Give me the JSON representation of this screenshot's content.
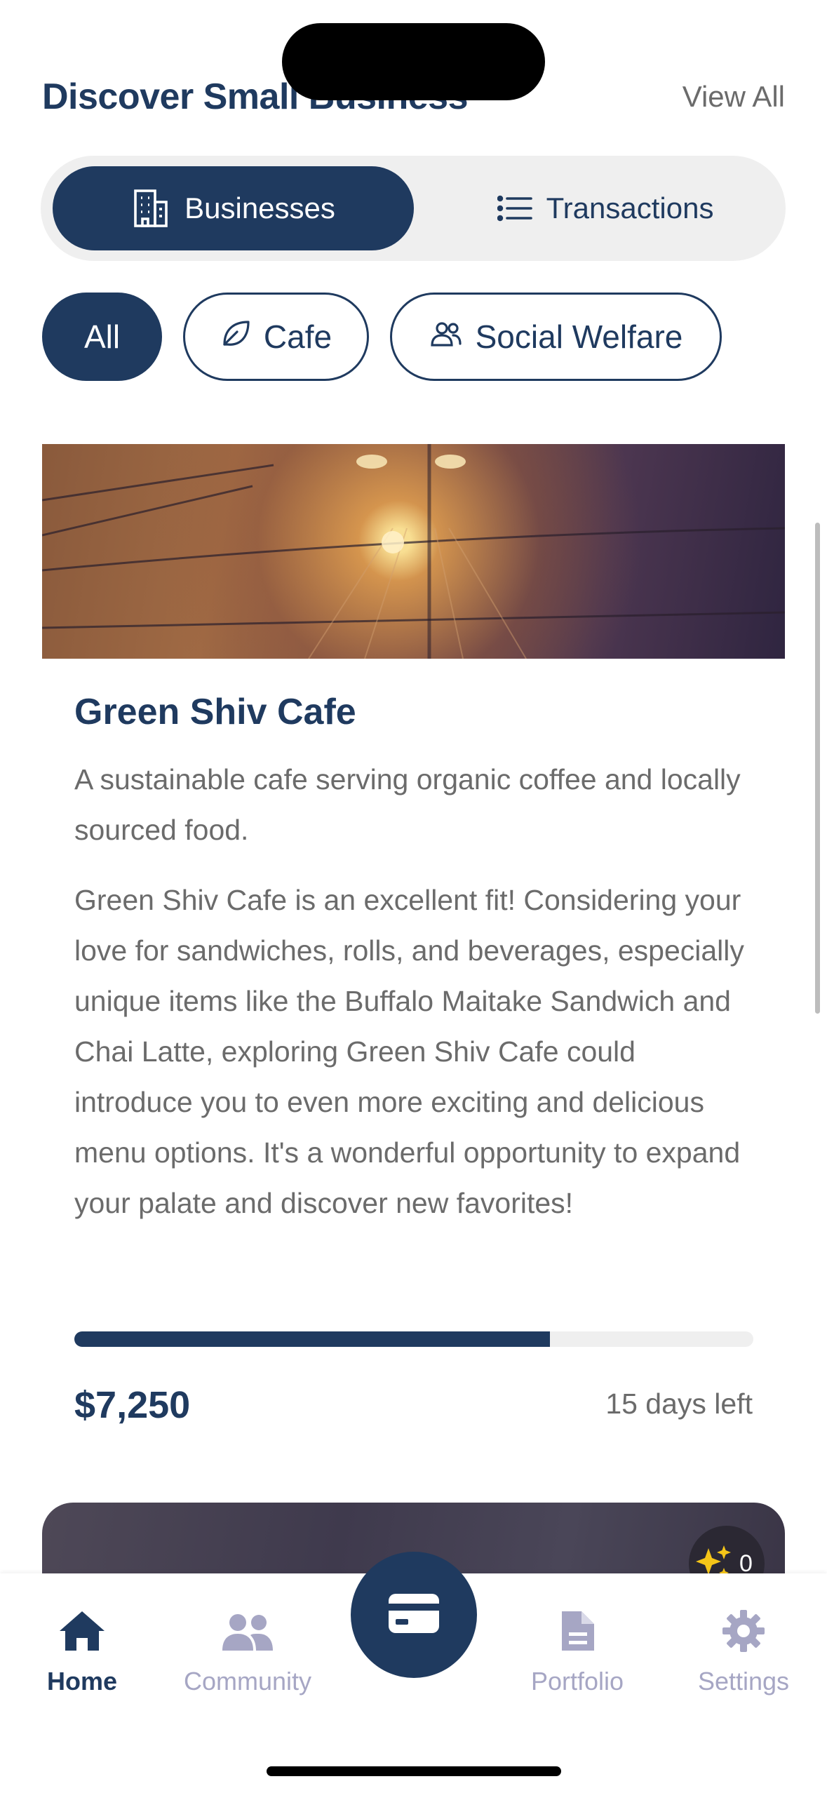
{
  "header": {
    "title": "Discover Small Business",
    "view_all": "View All"
  },
  "segmented": {
    "businesses": "Businesses",
    "transactions": "Transactions",
    "selected": "Businesses"
  },
  "filters": {
    "all": "All",
    "cafe": "Cafe",
    "social_welfare": "Social Welfare",
    "selected": "All"
  },
  "card": {
    "title": "Green Shiv Cafe",
    "subtitle": "A sustainable cafe serving organic coffee and locally sourced food.",
    "description": "Green Shiv Cafe is an excellent fit! Considering your love for sandwiches, rolls, and beverages, especially unique items like the Buffalo Maitake Sandwich and Chai Latte, exploring Green Shiv Cafe could introduce you to even more exciting and delicious menu options. It's a wonderful opportunity to expand your palate and discover new favorites!",
    "progress_fraction": 0.7,
    "amount": "$7,250",
    "days_left": "15 days left"
  },
  "next_card": {
    "sparkle_count": "0"
  },
  "tabbar": {
    "home": "Home",
    "community": "Community",
    "portfolio": "Portfolio",
    "settings": "Settings",
    "active": "Home"
  },
  "colors": {
    "primary": "#1f3a5f",
    "muted_text": "#6b6b6b",
    "inactive_tab": "#a6a6c4",
    "track": "#efefef"
  },
  "icons": {
    "segment_businesses": "building-icon",
    "segment_transactions": "list-icon",
    "chip_cafe": "leaf-icon",
    "chip_social": "people-icon",
    "tab_home": "house-icon",
    "tab_community": "users-icon",
    "tab_center": "credit-card-icon",
    "tab_portfolio": "document-icon",
    "tab_settings": "gear-icon",
    "badge": "sparkles-icon"
  }
}
